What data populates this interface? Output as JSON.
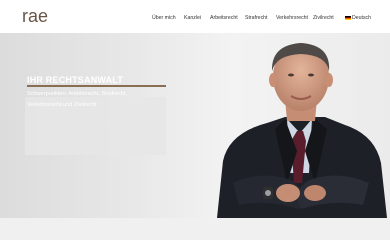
{
  "logo": {
    "icon": "rae-logo-icon",
    "text": "rae",
    "color": "#6b5545"
  },
  "nav": {
    "items": [
      {
        "label": "Über mich"
      },
      {
        "label": "Kanzlei"
      },
      {
        "label": "Arbeitsrecht"
      },
      {
        "label": "Strafrecht"
      },
      {
        "label": "Verkehrsrecht"
      },
      {
        "label": "Zivilrecht"
      }
    ],
    "language": {
      "label": "Deutsch",
      "icon": "german-flag-icon"
    }
  },
  "hero": {
    "title": "IHR RECHTSANWALT",
    "text_line_1": "Schwerpunkten: Arbeitsrecht, Strafrecht,",
    "text_line_2": "Verkehrsrecht und Zivilrecht",
    "accent_color": "#8a6d55"
  }
}
